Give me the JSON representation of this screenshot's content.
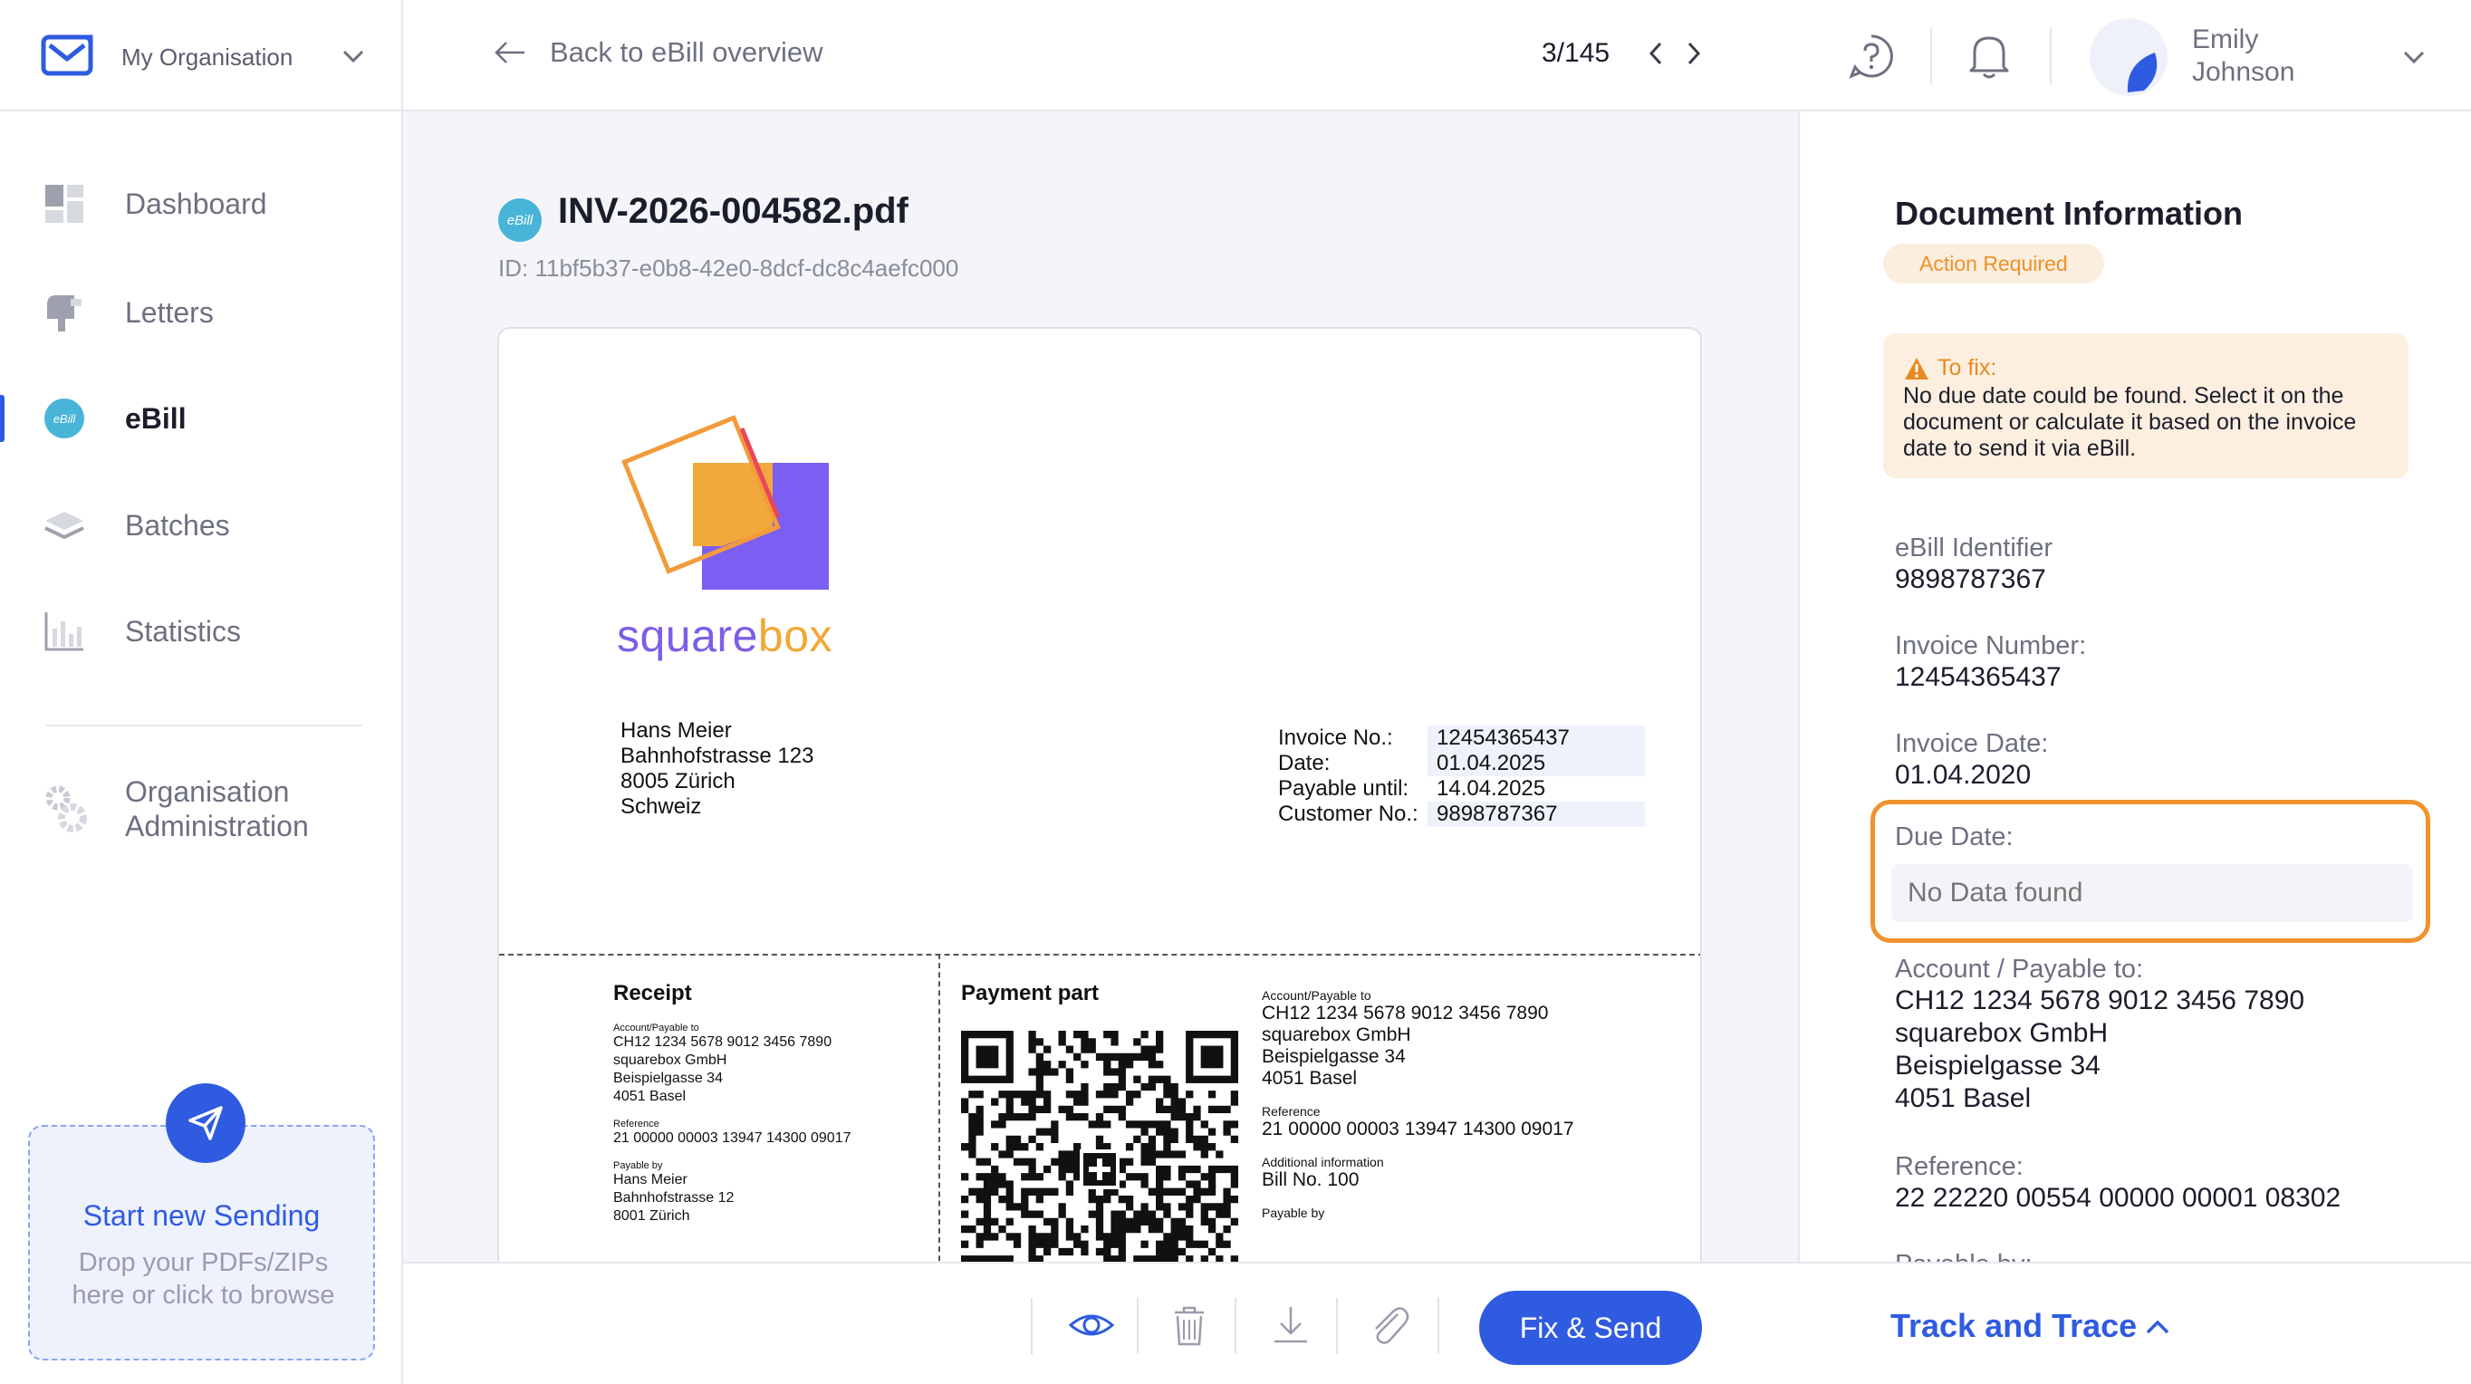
{
  "org": {
    "name": "My Organisation"
  },
  "nav": {
    "items": [
      {
        "label": "Dashboard",
        "icon": "dashboard-icon"
      },
      {
        "label": "Letters",
        "icon": "mailbox-icon"
      },
      {
        "label": "eBill",
        "icon": "ebill-icon"
      },
      {
        "label": "Batches",
        "icon": "layers-icon"
      },
      {
        "label": "Statistics",
        "icon": "bar-chart-icon"
      }
    ],
    "admin_label": "Organisation Administration"
  },
  "dropzone": {
    "title": "Start new Sending",
    "subtitle": "Drop your PDFs/ZIPs here or click to browse"
  },
  "topbar": {
    "back_label": "Back to eBill overview",
    "pager": "3/145",
    "user_first": "Emily",
    "user_last": "Johnson"
  },
  "document": {
    "badge": "eBill",
    "filename": "INV-2026-004582.pdf",
    "id": "ID: 11bf5b37-e0b8-42e0-8dcf-dc8c4aefc000",
    "brand": {
      "part1": "square",
      "part2": "box"
    },
    "address": [
      "Hans Meier",
      "Bahnhofstrasse 123",
      "8005 Zürich",
      "Schweiz"
    ],
    "invoice_info": [
      {
        "k": "Invoice No.:",
        "v": "12454365437"
      },
      {
        "k": "Date:",
        "v": "01.04.2025"
      },
      {
        "k": "Payable until:",
        "v": "14.04.2025"
      },
      {
        "k": "Customer No.:",
        "v": "9898787367"
      }
    ],
    "receipt": {
      "title": "Receipt",
      "account_label": "Account/Payable to",
      "account_lines": [
        "CH12 1234 5678 9012 3456 7890",
        "squarebox GmbH",
        "Beispielgasse 34",
        "4051 Basel"
      ],
      "reference_label": "Reference",
      "reference": "21 00000 00003 13947 14300 09017",
      "payable_by_label": "Payable by",
      "payable_by_lines": [
        "Hans Meier",
        "Bahnhofstrasse 12",
        "8001 Zürich"
      ]
    },
    "payment": {
      "title": "Payment part",
      "account_label": "Account/Payable to",
      "account_lines": [
        "CH12 1234 5678 9012 3456 7890",
        "squarebox GmbH",
        "Beispielgasse 34",
        "4051 Basel"
      ],
      "reference_label": "Reference",
      "reference": "21 00000 00003 13947 14300 09017",
      "additional_label": "Additional information",
      "additional": "Bill No. 100",
      "payable_by_label": "Payable by"
    }
  },
  "toolbar": {
    "fix_send_label": "Fix & Send"
  },
  "panel": {
    "title": "Document Information",
    "status": "Action Required",
    "fix_title": "To fix:",
    "fix_message": "No due date could be found. Select it on the document or calculate it based on the invoice date to send it via eBill.",
    "fields": [
      {
        "k": "eBill Identifier",
        "v": "9898787367"
      },
      {
        "k": "Invoice Number:",
        "v": "12454365437"
      },
      {
        "k": "Invoice Date:",
        "v": "01.04.2020"
      }
    ],
    "due_label": "Due Date:",
    "due_placeholder": "No Data found",
    "account_label": "Account / Payable to:",
    "account_lines": [
      "CH12 1234 5678 9012 3456 7890",
      "squarebox GmbH",
      "Beispielgasse 34",
      "4051 Basel"
    ],
    "reference_label": "Reference:",
    "reference": "22 22220 00554 00000 00001 08302",
    "payable_by_label": "Payable by:"
  },
  "track": {
    "label": "Track and Trace"
  },
  "colors": {
    "accent": "#2f5be0",
    "warning": "#f0932f",
    "ebill": "#48b4d8"
  }
}
